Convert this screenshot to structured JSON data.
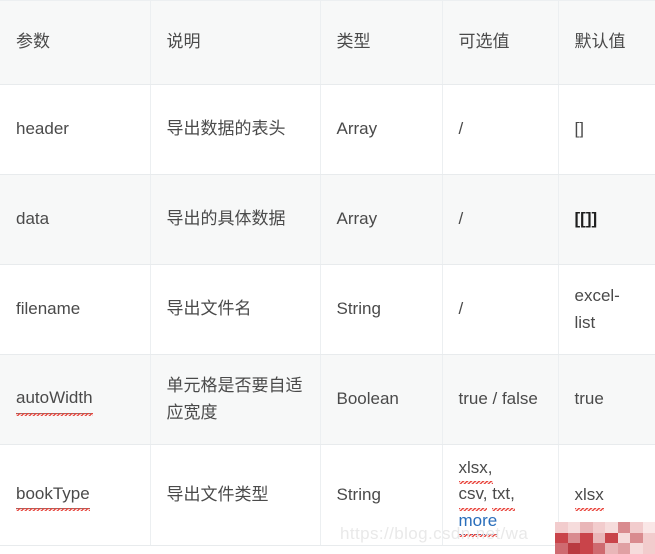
{
  "table": {
    "columns": [
      {
        "key": "param",
        "label": "参数"
      },
      {
        "key": "desc",
        "label": "说明"
      },
      {
        "key": "type",
        "label": "类型"
      },
      {
        "key": "options",
        "label": "可选值"
      },
      {
        "key": "default",
        "label": "默认值"
      }
    ],
    "rows": [
      {
        "param": "header",
        "desc": "导出数据的表头",
        "type": "Array",
        "options": "/",
        "default": "[]"
      },
      {
        "param": "data",
        "desc": "导出的具体数据",
        "type": "Array",
        "options": "/",
        "default": "[[]]"
      },
      {
        "param": "filename",
        "desc": "导出文件名",
        "type": "String",
        "options": "/",
        "default": "excel-list"
      },
      {
        "param": "autoWidth",
        "desc": "单元格是否要自适应宽度",
        "type": "Boolean",
        "options": "true / false",
        "default": "true"
      },
      {
        "param": "bookType",
        "desc": "导出文件类型",
        "type": "String",
        "options_line1": "xlsx,",
        "options_line2_a": "csv,",
        "options_line2_b": "txt,",
        "options_more_link": "more",
        "default": "xlsx"
      }
    ]
  },
  "watermark": {
    "text": "https://blog.csdn.net/wa"
  },
  "colors": {
    "header_bg": "#f7f8f8",
    "stripe_bg": "#f7f8f8",
    "border": "#eceff1",
    "text": "#4a4a4a",
    "heading_text": "#1f1f1f",
    "link": "#2a6ebb",
    "spellcheck_underline": "#e8433a",
    "watermark": "#e9e9e9",
    "mosaic_primary": "#c9444a",
    "mosaic_light": "#f4d3d4"
  }
}
